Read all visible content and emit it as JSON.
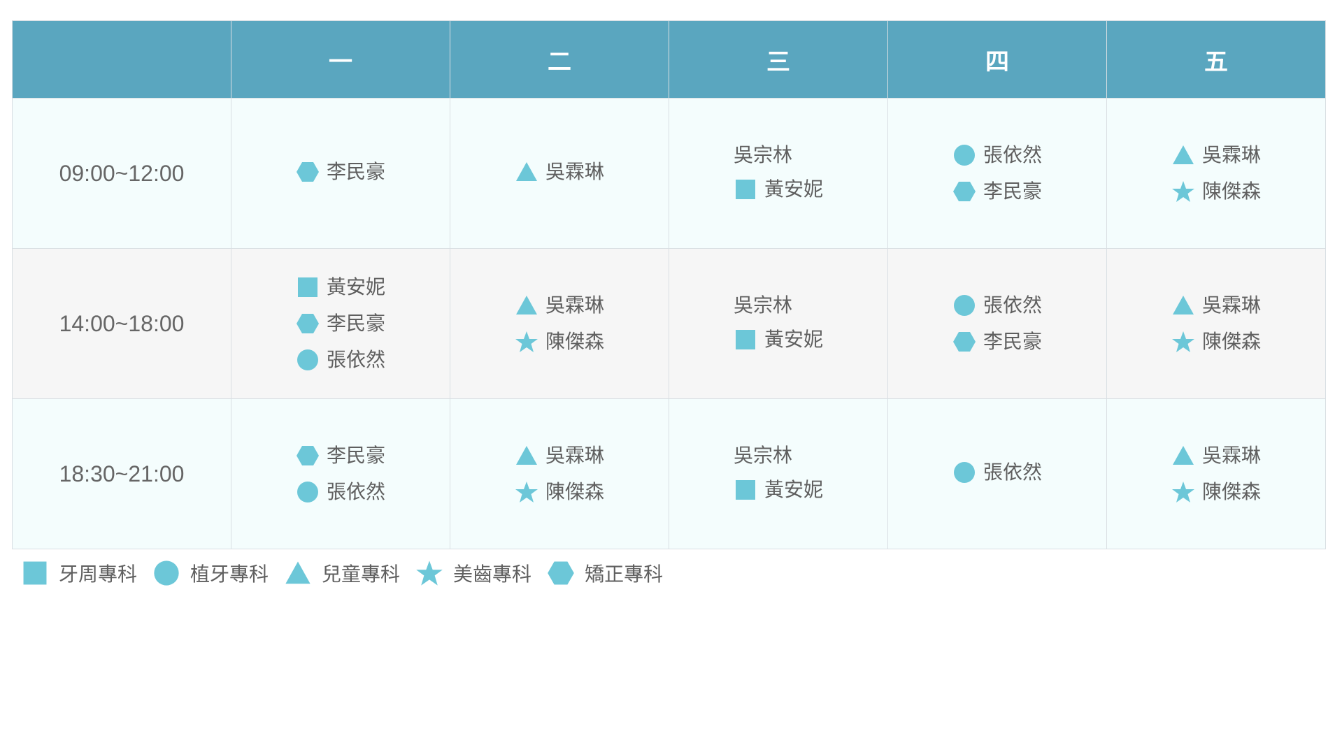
{
  "colors": {
    "header_bg": "#5aa6bf",
    "icon": "#6cc7d8",
    "row_light": "#f4fdfd",
    "row_alt": "#f6f6f6"
  },
  "header": {
    "corner": "",
    "days": [
      "一",
      "二",
      "三",
      "四",
      "五"
    ]
  },
  "rows": [
    {
      "time": "09:00~12:00",
      "cells": [
        [
          {
            "icon": "hexagon-icon",
            "name": "李民豪"
          }
        ],
        [
          {
            "icon": "triangle-icon",
            "name": "吳霖琳"
          }
        ],
        [
          {
            "icon": "",
            "name": "吳宗林"
          },
          {
            "icon": "square-icon",
            "name": "黃安妮"
          }
        ],
        [
          {
            "icon": "circle-icon",
            "name": "張依然"
          },
          {
            "icon": "hexagon-icon",
            "name": "李民豪"
          }
        ],
        [
          {
            "icon": "triangle-icon",
            "name": "吳霖琳"
          },
          {
            "icon": "star-icon",
            "name": "陳傑森"
          }
        ]
      ]
    },
    {
      "time": "14:00~18:00",
      "cells": [
        [
          {
            "icon": "square-icon",
            "name": "黃安妮"
          },
          {
            "icon": "hexagon-icon",
            "name": "李民豪"
          },
          {
            "icon": "circle-icon",
            "name": "張依然"
          }
        ],
        [
          {
            "icon": "triangle-icon",
            "name": "吳霖琳"
          },
          {
            "icon": "star-icon",
            "name": "陳傑森"
          }
        ],
        [
          {
            "icon": "",
            "name": "吳宗林"
          },
          {
            "icon": "square-icon",
            "name": "黃安妮"
          }
        ],
        [
          {
            "icon": "circle-icon",
            "name": "張依然"
          },
          {
            "icon": "hexagon-icon",
            "name": "李民豪"
          }
        ],
        [
          {
            "icon": "triangle-icon",
            "name": "吳霖琳"
          },
          {
            "icon": "star-icon",
            "name": "陳傑森"
          }
        ]
      ]
    },
    {
      "time": "18:30~21:00",
      "cells": [
        [
          {
            "icon": "hexagon-icon",
            "name": "李民豪"
          },
          {
            "icon": "circle-icon",
            "name": "張依然"
          }
        ],
        [
          {
            "icon": "triangle-icon",
            "name": "吳霖琳"
          },
          {
            "icon": "star-icon",
            "name": "陳傑森"
          }
        ],
        [
          {
            "icon": "",
            "name": "吳宗林"
          },
          {
            "icon": "square-icon",
            "name": "黃安妮"
          }
        ],
        [
          {
            "icon": "circle-icon",
            "name": "張依然"
          }
        ],
        [
          {
            "icon": "triangle-icon",
            "name": "吳霖琳"
          },
          {
            "icon": "star-icon",
            "name": "陳傑森"
          }
        ]
      ]
    }
  ],
  "legend": [
    {
      "icon": "square-icon",
      "label": "牙周專科"
    },
    {
      "icon": "circle-icon",
      "label": "植牙專科"
    },
    {
      "icon": "triangle-icon",
      "label": "兒童專科"
    },
    {
      "icon": "star-icon",
      "label": "美齒專科"
    },
    {
      "icon": "hexagon-icon",
      "label": "矯正專科"
    }
  ]
}
